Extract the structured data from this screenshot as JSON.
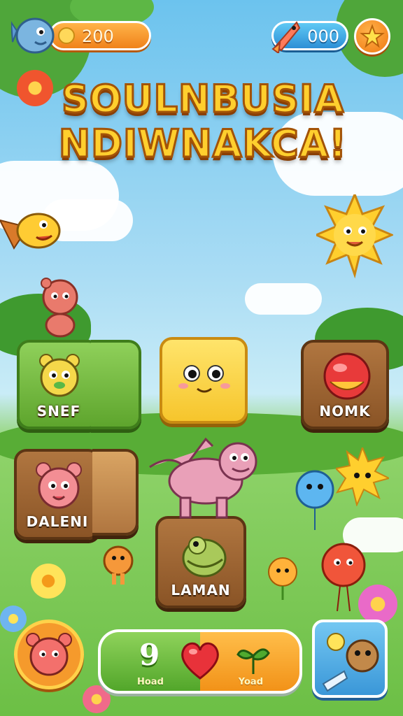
{
  "hud": {
    "coins": "200",
    "gems": "000",
    "icons": {
      "avatar": "fish-avatar-icon",
      "coin": "coin-icon",
      "gem": "fish-gem-icon",
      "favorite": "star-icon"
    }
  },
  "title": {
    "line1": "SOULNBUSIA",
    "line2": "NDIWNAKCA!"
  },
  "tiles": [
    {
      "label": "SNEF",
      "style": "green",
      "icon": "bear-face-icon"
    },
    {
      "label": "",
      "style": "yellow",
      "icon": "smiling-block-icon"
    },
    {
      "label": "NOMK",
      "style": "wood",
      "icon": "red-ball-icon"
    },
    {
      "label": "DALENI",
      "style": "wood",
      "icon": "pink-bear-face-icon"
    },
    {
      "label": "LAMAN",
      "style": "wood",
      "icon": "green-creature-icon"
    }
  ],
  "bottom_bar": {
    "count": "9",
    "left_caption": "Hoad",
    "right_caption": "Yoad",
    "icons": {
      "middle": "heart-icon",
      "right": "green-sprout-icon"
    }
  },
  "colors": {
    "title_fill": "#ffcf2e",
    "title_stroke": "#a35307",
    "coin_pill": "#f0821a",
    "gem_pill": "#2d8fd6",
    "grass": "#6cbf45",
    "sky": "#6cc3ee"
  }
}
